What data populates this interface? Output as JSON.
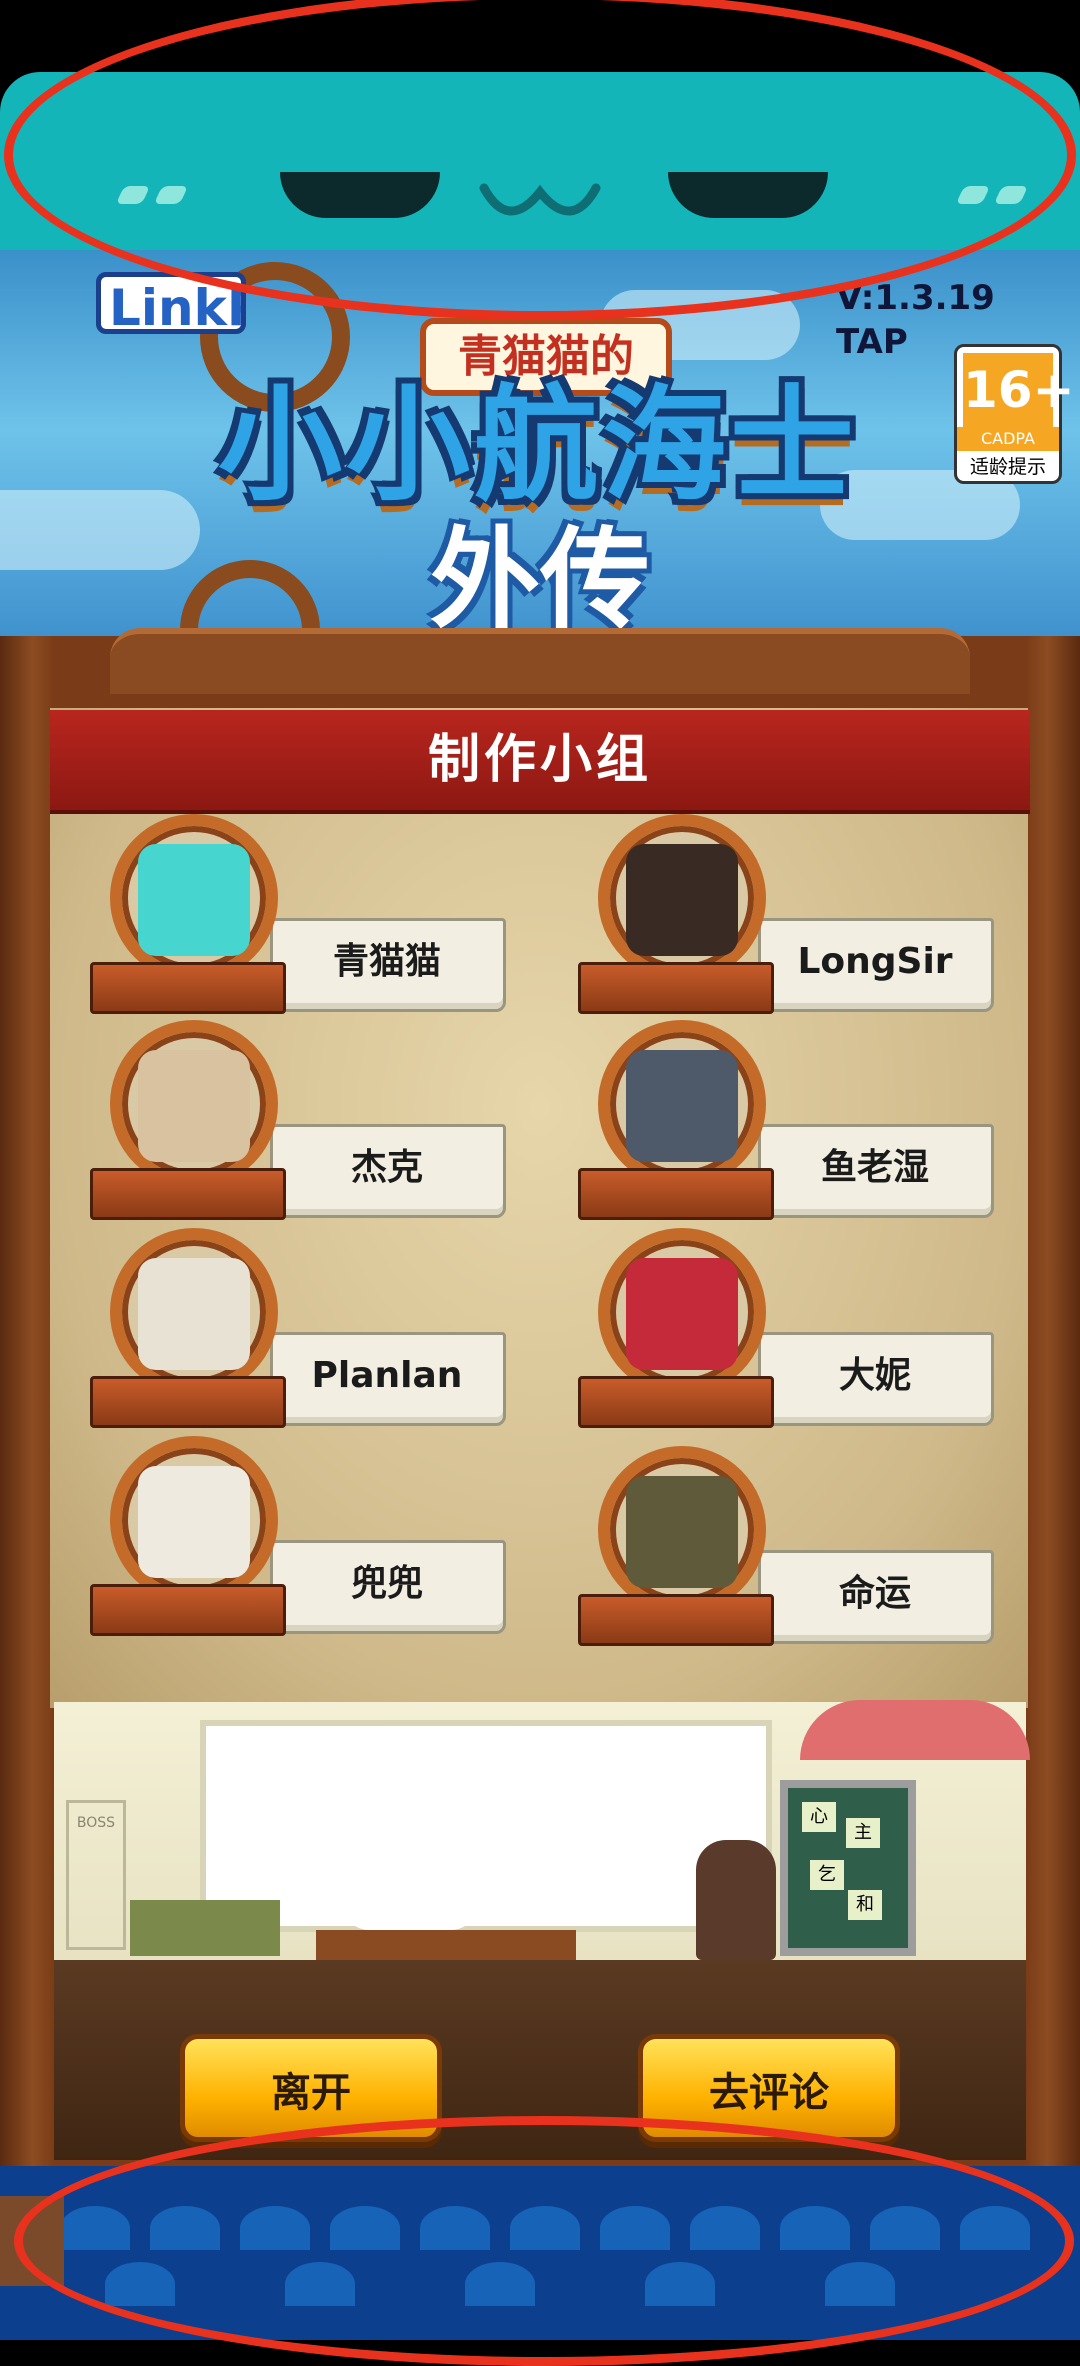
{
  "header": {
    "logo_brand": "LinkPaw",
    "logo_subtitle": "青猫猫的",
    "logo_title": "小小航海士",
    "logo_tagline": "外传",
    "version": "V:1.3.19 TAP",
    "age_rating": {
      "number": "16+",
      "org": "CADPA",
      "tip": "适龄提示"
    }
  },
  "panel": {
    "title": "制作小组",
    "members": [
      {
        "name": "青猫猫",
        "icon": "teal-cat-avatar"
      },
      {
        "name": "LongSir",
        "icon": "pirate-captain-avatar"
      },
      {
        "name": "杰克",
        "icon": "hockey-mask-avatar"
      },
      {
        "name": "鱼老湿",
        "icon": "shark-mask-avatar"
      },
      {
        "name": "Planlan",
        "icon": "mummy-avatar"
      },
      {
        "name": "大妮",
        "icon": "red-hood-avatar"
      },
      {
        "name": "兜兜",
        "icon": "bunny-ears-avatar"
      },
      {
        "name": "命运",
        "icon": "wizard-hat-avatar"
      }
    ],
    "scene": {
      "board_text": [
        "心",
        "主",
        "乞",
        "和"
      ],
      "door_text": "BOSS"
    }
  },
  "buttons": {
    "leave": "离开",
    "review": "去评论"
  },
  "colors": {
    "title_red": "#b8261e",
    "teal": "#13b5b8",
    "button_yellow": "#ffc400",
    "wood": "#8a4a22",
    "sea_blue": "#0d3f8f"
  }
}
